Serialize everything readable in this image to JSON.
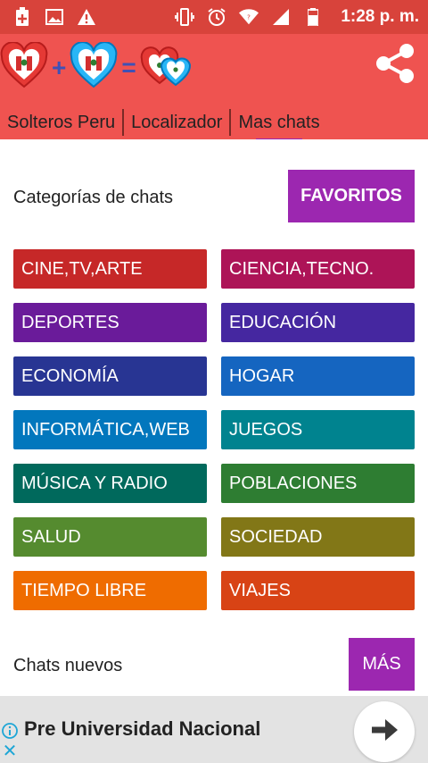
{
  "status_bar": {
    "time": "1:28 p. m.",
    "left_icons": [
      "notification-plus-icon",
      "image-icon",
      "warning-icon"
    ],
    "right_icons": [
      "vibrate-icon",
      "alarm-icon",
      "wifi-icon",
      "signal-icon",
      "battery-icon"
    ]
  },
  "header": {
    "plus": "+",
    "equals": "=",
    "tabs": [
      {
        "label": "Solteros Peru"
      },
      {
        "label": "Localizador"
      },
      {
        "label": "Mas chats"
      }
    ],
    "active_tab": "Mas chats"
  },
  "content": {
    "categories_title": "Categorías de chats",
    "favorites_label": "FAVORITOS",
    "categories": [
      {
        "label": "CINE,TV,ARTE",
        "color": "#c62828"
      },
      {
        "label": "CIENCIA,TECNO.",
        "color": "#ad1457"
      },
      {
        "label": "DEPORTES",
        "color": "#6a1b9a"
      },
      {
        "label": "EDUCACIÓN",
        "color": "#4527a0"
      },
      {
        "label": "ECONOMÍA",
        "color": "#283593"
      },
      {
        "label": "HOGAR",
        "color": "#1565c0"
      },
      {
        "label": "INFORMÁTICA,WEB",
        "color": "#0277bd"
      },
      {
        "label": "JUEGOS",
        "color": "#00838f"
      },
      {
        "label": "MÚSICA Y RADIO",
        "color": "#00695c"
      },
      {
        "label": "POBLACIONES",
        "color": "#2e7d32"
      },
      {
        "label": "SALUD",
        "color": "#558b2f"
      },
      {
        "label": "SOCIEDAD",
        "color": "#827717"
      },
      {
        "label": "TIEMPO LIBRE",
        "color": "#ef6c00"
      },
      {
        "label": "VIAJES",
        "color": "#d84315"
      }
    ],
    "new_chats_title": "Chats nuevos",
    "more_label": "MÁS"
  },
  "ad": {
    "text": "Pre Universidad Nacional",
    "close_symbol": "✕"
  },
  "colors": {
    "status_bar": "#d8433b",
    "header": "#ef5350",
    "accent_purple": "#9c27b0",
    "heart_red": "#e53935",
    "heart_blue": "#29b6f6"
  }
}
